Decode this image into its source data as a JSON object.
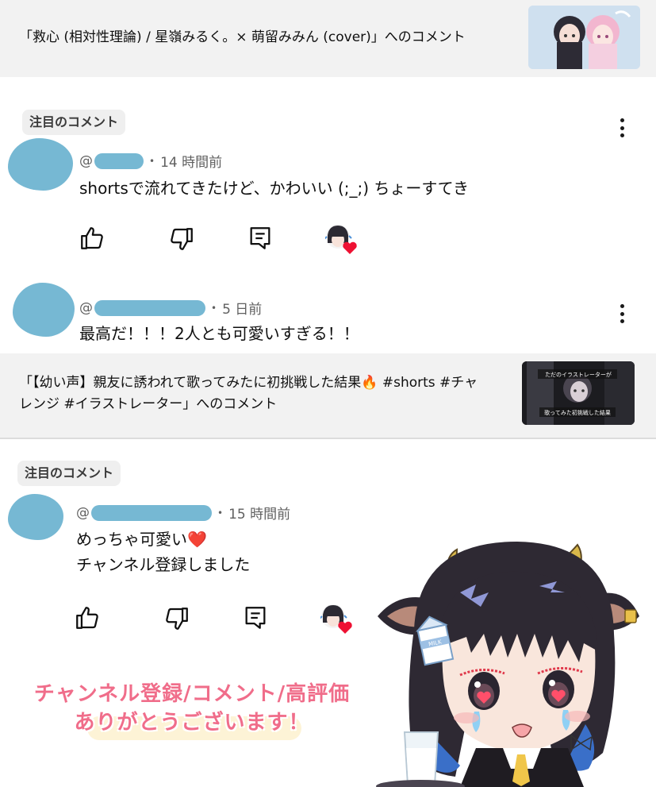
{
  "videos": [
    {
      "title": "「救心 (相対性理論) / 星嶺みるく。× 萌留みみん (cover)」へのコメント",
      "comments": [
        {
          "badge": "注目のコメント",
          "at": "@",
          "time": "14 時間前",
          "text_lines": [
            "shortsで流れてきたけど、かわいい (;_;) ちょーすてき"
          ]
        },
        {
          "at": "@",
          "time": "5 日前",
          "text_lines": [
            "最高だ！！！2人とも可愛いすぎる！！"
          ]
        }
      ]
    },
    {
      "title_lines": [
        "「【幼い声】親友に誘われて歌ってみたに初挑戦した結果🔥 #shorts #チャ",
        "レンジ #イラストレーター」へのコメント"
      ],
      "thumb_lines": [
        "ただのイラストレーターが",
        "歌ってみた初挑戦した結果"
      ],
      "comments": [
        {
          "badge": "注目のコメント",
          "at": "@",
          "time": "15 時間前",
          "text_lines": [
            "めっちゃ可愛い❤️",
            "チャンネル登録しました"
          ]
        }
      ]
    }
  ],
  "promo": {
    "line1": "チャンネル登録/コメント/高評価",
    "line2": "ありがとうございます！"
  },
  "mascot": {
    "carton_label": "MILK"
  },
  "icons": [
    "thumb-up-icon",
    "thumb-down-icon",
    "reply-icon",
    "creator-heart-icon",
    "more-vert-icon"
  ],
  "colors": {
    "header_bg": "#f2f2f2",
    "redacted": "#76b8d3",
    "promo_pink": "#f06d8a",
    "heart_red": "#ee1133"
  }
}
